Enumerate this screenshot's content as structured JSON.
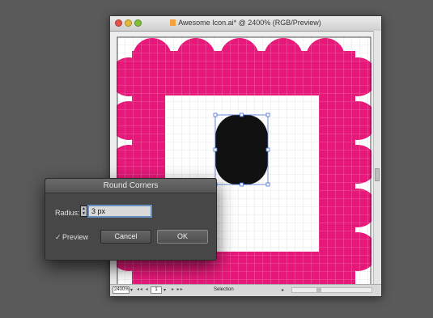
{
  "document": {
    "title": "Awesome Icon.ai* @ 2400% (RGB/Preview)",
    "zoom": "2400%",
    "page": "1",
    "status": "Selection"
  },
  "dialog": {
    "title": "Round Corners",
    "radius_label": "Radius:",
    "radius_value": "3 px",
    "preview_label": "Preview",
    "preview_check": "✓",
    "cancel_label": "Cancel",
    "ok_label": "OK"
  },
  "colors": {
    "shape_pink": "#e8187a",
    "inner_black": "#111111",
    "selection_blue": "#4a6fd0"
  }
}
